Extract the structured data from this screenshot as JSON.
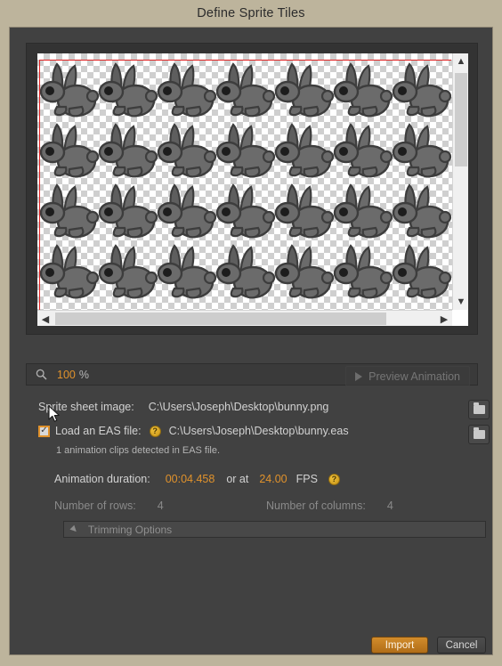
{
  "window": {
    "title": "Define Sprite Tiles"
  },
  "preview": {
    "zoom_icon": "search-icon",
    "zoom_value": "100",
    "zoom_unit": "%",
    "preview_animation_label": "Preview Animation",
    "play_icon": "play-icon",
    "scroll_up_icon": "chevron-up-icon",
    "scroll_down_icon": "chevron-down-icon",
    "scroll_left_icon": "chevron-left-icon",
    "scroll_right_icon": "chevron-right-icon"
  },
  "form": {
    "sprite_sheet_label": "Sprite sheet image:",
    "sprite_sheet_value": "C:\\Users\\Joseph\\Desktop\\bunny.png",
    "eas_checkbox_label": "Load an EAS file:",
    "eas_checkbox_checked": "✓",
    "eas_value": "C:\\Users\\Joseph\\Desktop\\bunny.eas",
    "eas_help_icon": "help-icon",
    "eas_help_glyph": "?",
    "clips_detected_note": "1 animation clips detected in EAS file.",
    "duration_label": "Animation duration:",
    "duration_value": "00:04.458",
    "or_at_label": "or at",
    "fps_value": "24.00",
    "fps_label": "FPS",
    "fps_help_glyph": "?",
    "rows_label": "Number of rows:",
    "rows_value": "4",
    "columns_label": "Number of columns:",
    "columns_value": "4",
    "trimming_label": "Trimming Options",
    "browse_icon": "folder-icon"
  },
  "footer": {
    "import_label": "Import",
    "cancel_label": "Cancel"
  },
  "colors": {
    "window_chrome": "#bdb49c",
    "panel": "#414141",
    "accent_orange": "#e0922c",
    "selection_red": "#e02020",
    "help_yellow": "#d7a41c"
  }
}
